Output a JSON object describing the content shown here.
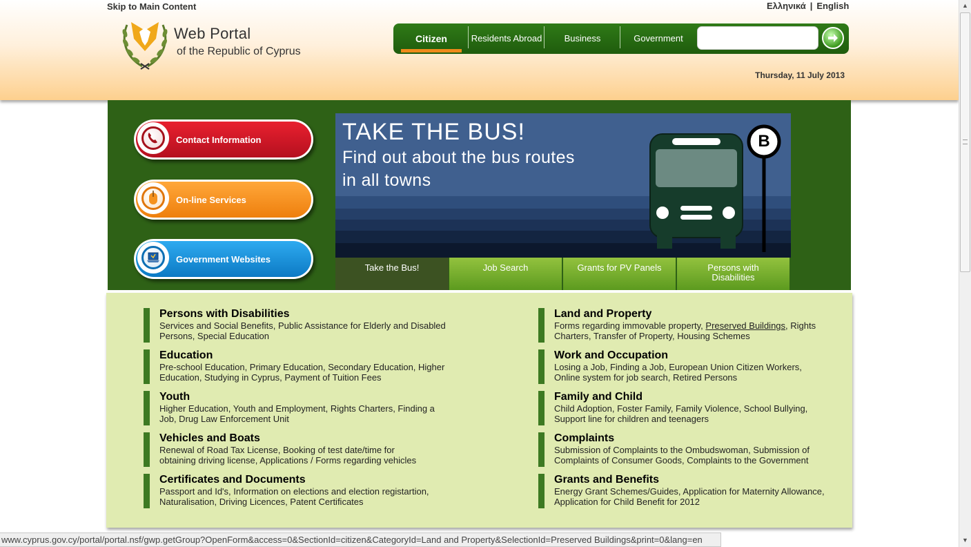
{
  "header": {
    "skip_link": "Skip to Main Content",
    "lang_greek": "Ελληνικά",
    "lang_sep": "|",
    "lang_english": "English",
    "logo_title": "Web Portal",
    "logo_subtitle": "of the Republic of Cyprus",
    "date": "Thursday, 11 July 2013",
    "search": {
      "value": "",
      "placeholder": ""
    }
  },
  "nav": {
    "tabs": [
      {
        "label": "Citizen",
        "active": true
      },
      {
        "label": "Residents Abroad",
        "active": false
      },
      {
        "label": "Business",
        "active": false
      },
      {
        "label": "Government",
        "active": false
      }
    ]
  },
  "quick_links": [
    {
      "label": "Contact Information",
      "icon": "phone-icon",
      "color": "#d3152a"
    },
    {
      "label": "On-line Services",
      "icon": "mouse-icon",
      "color": "#f5921e"
    },
    {
      "label": "Government Websites",
      "icon": "laptop-icon",
      "color": "#1a8fd8"
    }
  ],
  "promo": {
    "title": "TAKE THE BUS!",
    "subtitle_line1": "Find out about the bus routes",
    "subtitle_line2": "in all towns",
    "bus_stop_letter": "B",
    "tabs": [
      {
        "label": "Take the Bus!",
        "active": true
      },
      {
        "label": "Job Search",
        "active": false
      },
      {
        "label": "Grants for PV Panels",
        "active": false
      },
      {
        "label": "Persons with Disabilities",
        "active": false
      }
    ]
  },
  "categories_left": [
    {
      "title": "Persons with Disabilities",
      "desc": "Services and Social Benefits, Public Assistance for Elderly and Disabled Persons, Special Education"
    },
    {
      "title": "Education",
      "desc": "Pre-school Education, Primary Education, Secondary Education, Higher Education, Studying in Cyprus, Payment of Tuition Fees"
    },
    {
      "title": "Youth",
      "desc": "Higher Education, Youth and Employment, Rights Charters, Finding a Job, Drug Law Enforcement Unit"
    },
    {
      "title": "Vehicles and Boats",
      "desc": "Renewal of Road Tax License, Booking of test date/time for obtaining driving license, Applications / Forms regarding vehicles"
    },
    {
      "title": "Certificates and Documents",
      "desc": "Passport and Id's, Information on elections and election registartion, Naturalisation, Driving Licences, Patent Certificates"
    }
  ],
  "categories_right": [
    {
      "title": "Land and Property",
      "desc_before": "Forms regarding immovable property, ",
      "desc_link": "Preserved Buildings",
      "desc_after": ", Rights Charters, Transfer of Property, Housing Schemes"
    },
    {
      "title": "Work and Occupation",
      "desc": "Losing a Job, Finding a Job, European Union Citizen Workers, Online system for job search, Retired Persons"
    },
    {
      "title": "Family and Child",
      "desc": "Child Adoption, Foster Family, Family Violence, School Bullying, Support line for children and teenagers"
    },
    {
      "title": "Complaints",
      "desc": "Submission of Complaints to the Ombudswoman, Submission of Complaints of Consumer Goods, Complaints to the Government"
    },
    {
      "title": "Grants and Benefits",
      "desc": "Energy Grant Schemes/Guides, Application for Maternity Allowance, Application for Child Benefit for 2012"
    }
  ],
  "status_bar": "www.cyprus.gov.cy/portal/portal.nsf/gwp.getGroup?OpenForm&access=0&SectionId=citizen&CategoryId=Land and Property&SelectionId=Preserved Buildings&print=0&lang=en",
  "colors": {
    "nav_green": "#2f7a17",
    "banner_green": "#2e6116",
    "active_underline": "#ef8a1a",
    "content_bg": "#e0ebb1"
  }
}
